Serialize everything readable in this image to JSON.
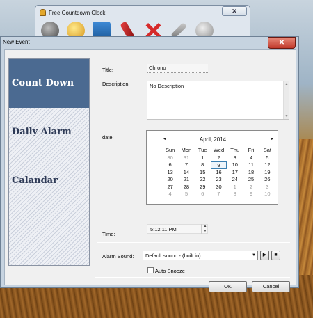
{
  "clock_window": {
    "title": "Free Countdown Clock",
    "close": "✕"
  },
  "dialog": {
    "title": "New Event",
    "close": "✕"
  },
  "sidebar": {
    "items": [
      {
        "label": "Count Down"
      },
      {
        "label": "Daily Alarm"
      },
      {
        "label": "Calandar"
      }
    ]
  },
  "form": {
    "title_label": "Title:",
    "title_value": "Chrono",
    "description_label": "Description:",
    "description_value": "No Description",
    "date_label": "date:",
    "time_label": "Time:",
    "time_value": "5:12:11 PM",
    "alarm_label": "Alarm Sound:",
    "alarm_value": "Default sound - (built in)",
    "auto_snooze_label": "Auto Snooze"
  },
  "calendar": {
    "month_label": "April, 2014",
    "prev": "◂",
    "next": "▸",
    "days": [
      "Sun",
      "Mon",
      "Tue",
      "Wed",
      "Thu",
      "Fri",
      "Sat"
    ],
    "weeks": [
      [
        "30",
        "31",
        "1",
        "2",
        "3",
        "4",
        "5"
      ],
      [
        "6",
        "7",
        "8",
        "9",
        "10",
        "11",
        "12"
      ],
      [
        "13",
        "14",
        "15",
        "16",
        "17",
        "18",
        "19"
      ],
      [
        "20",
        "21",
        "22",
        "23",
        "24",
        "25",
        "26"
      ],
      [
        "27",
        "28",
        "29",
        "30",
        "1",
        "2",
        "3"
      ],
      [
        "4",
        "5",
        "6",
        "7",
        "8",
        "9",
        "10"
      ]
    ]
  },
  "buttons": {
    "ok": "OK",
    "cancel": "Cancel",
    "play": "▶",
    "stop": "■"
  }
}
